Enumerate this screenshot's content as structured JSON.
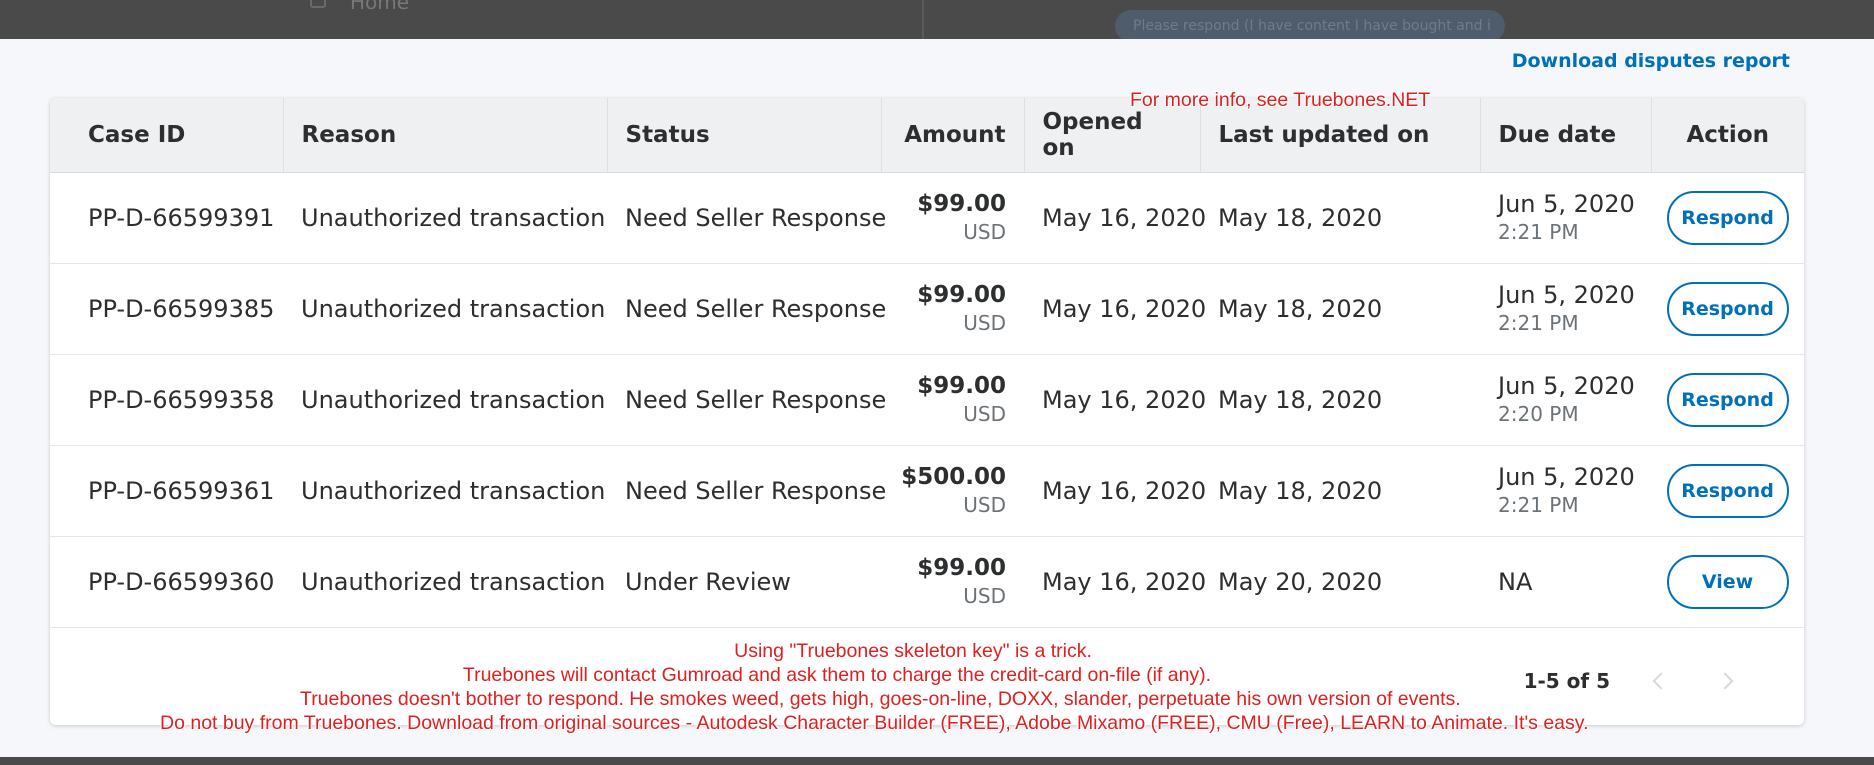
{
  "background": {
    "nav_item_label": "Home",
    "banner_text": "Please respond (I have content I have bought and i"
  },
  "download_link": "Download disputes report",
  "table": {
    "headers": {
      "case_id": "Case ID",
      "reason": "Reason",
      "status": "Status",
      "amount": "Amount",
      "opened_on": "Opened on",
      "last_updated_on": "Last updated on",
      "due_date": "Due date",
      "action": "Action"
    },
    "rows": [
      {
        "case_id": "PP-D-66599391",
        "reason": "Unauthorized transaction",
        "status": "Need Seller Response",
        "amount": "$99.00",
        "currency": "USD",
        "opened_on": "May 16, 2020",
        "last_updated_on": "May 18, 2020",
        "due_date": "Jun 5, 2020",
        "due_time": "2:21 PM",
        "action": "Respond"
      },
      {
        "case_id": "PP-D-66599385",
        "reason": "Unauthorized transaction",
        "status": "Need Seller Response",
        "amount": "$99.00",
        "currency": "USD",
        "opened_on": "May 16, 2020",
        "last_updated_on": "May 18, 2020",
        "due_date": "Jun 5, 2020",
        "due_time": "2:21 PM",
        "action": "Respond"
      },
      {
        "case_id": "PP-D-66599358",
        "reason": "Unauthorized transaction",
        "status": "Need Seller Response",
        "amount": "$99.00",
        "currency": "USD",
        "opened_on": "May 16, 2020",
        "last_updated_on": "May 18, 2020",
        "due_date": "Jun 5, 2020",
        "due_time": "2:20 PM",
        "action": "Respond"
      },
      {
        "case_id": "PP-D-66599361",
        "reason": "Unauthorized transaction",
        "status": "Need Seller Response",
        "amount": "$500.00",
        "currency": "USD",
        "opened_on": "May 16, 2020",
        "last_updated_on": "May 18, 2020",
        "due_date": "Jun 5, 2020",
        "due_time": "2:21 PM",
        "action": "Respond"
      },
      {
        "case_id": "PP-D-66599360",
        "reason": "Unauthorized transaction",
        "status": "Under Review",
        "amount": "$99.00",
        "currency": "USD",
        "opened_on": "May 16, 2020",
        "last_updated_on": "May 20, 2020",
        "due_date": "NA",
        "due_time": "",
        "action": "View"
      }
    ]
  },
  "pagination": {
    "range": "1-5 of 5",
    "prev_icon": "chevron-left-icon",
    "next_icon": "chevron-right-icon"
  },
  "annotations": {
    "top": "For more info, see Truebones.NET",
    "line1": "Using \"Truebones skeleton key\" is a trick.",
    "line2": "Truebones will contact Gumroad and ask them to charge the credit-card on-file (if any).",
    "line3": "Truebones doesn't bother to respond. He smokes weed, gets high, goes-on-line, DOXX, slander, perpetuate his own version of events.",
    "line4": "Do not buy from Truebones. Download from original sources - Autodesk Character Builder (FREE), Adobe Mixamo (FREE), CMU (Free), LEARN to Animate. It's easy."
  },
  "colors": {
    "accent": "#0070ba",
    "annotation_red": "#e02020",
    "header_bg": "#eef0f2"
  }
}
